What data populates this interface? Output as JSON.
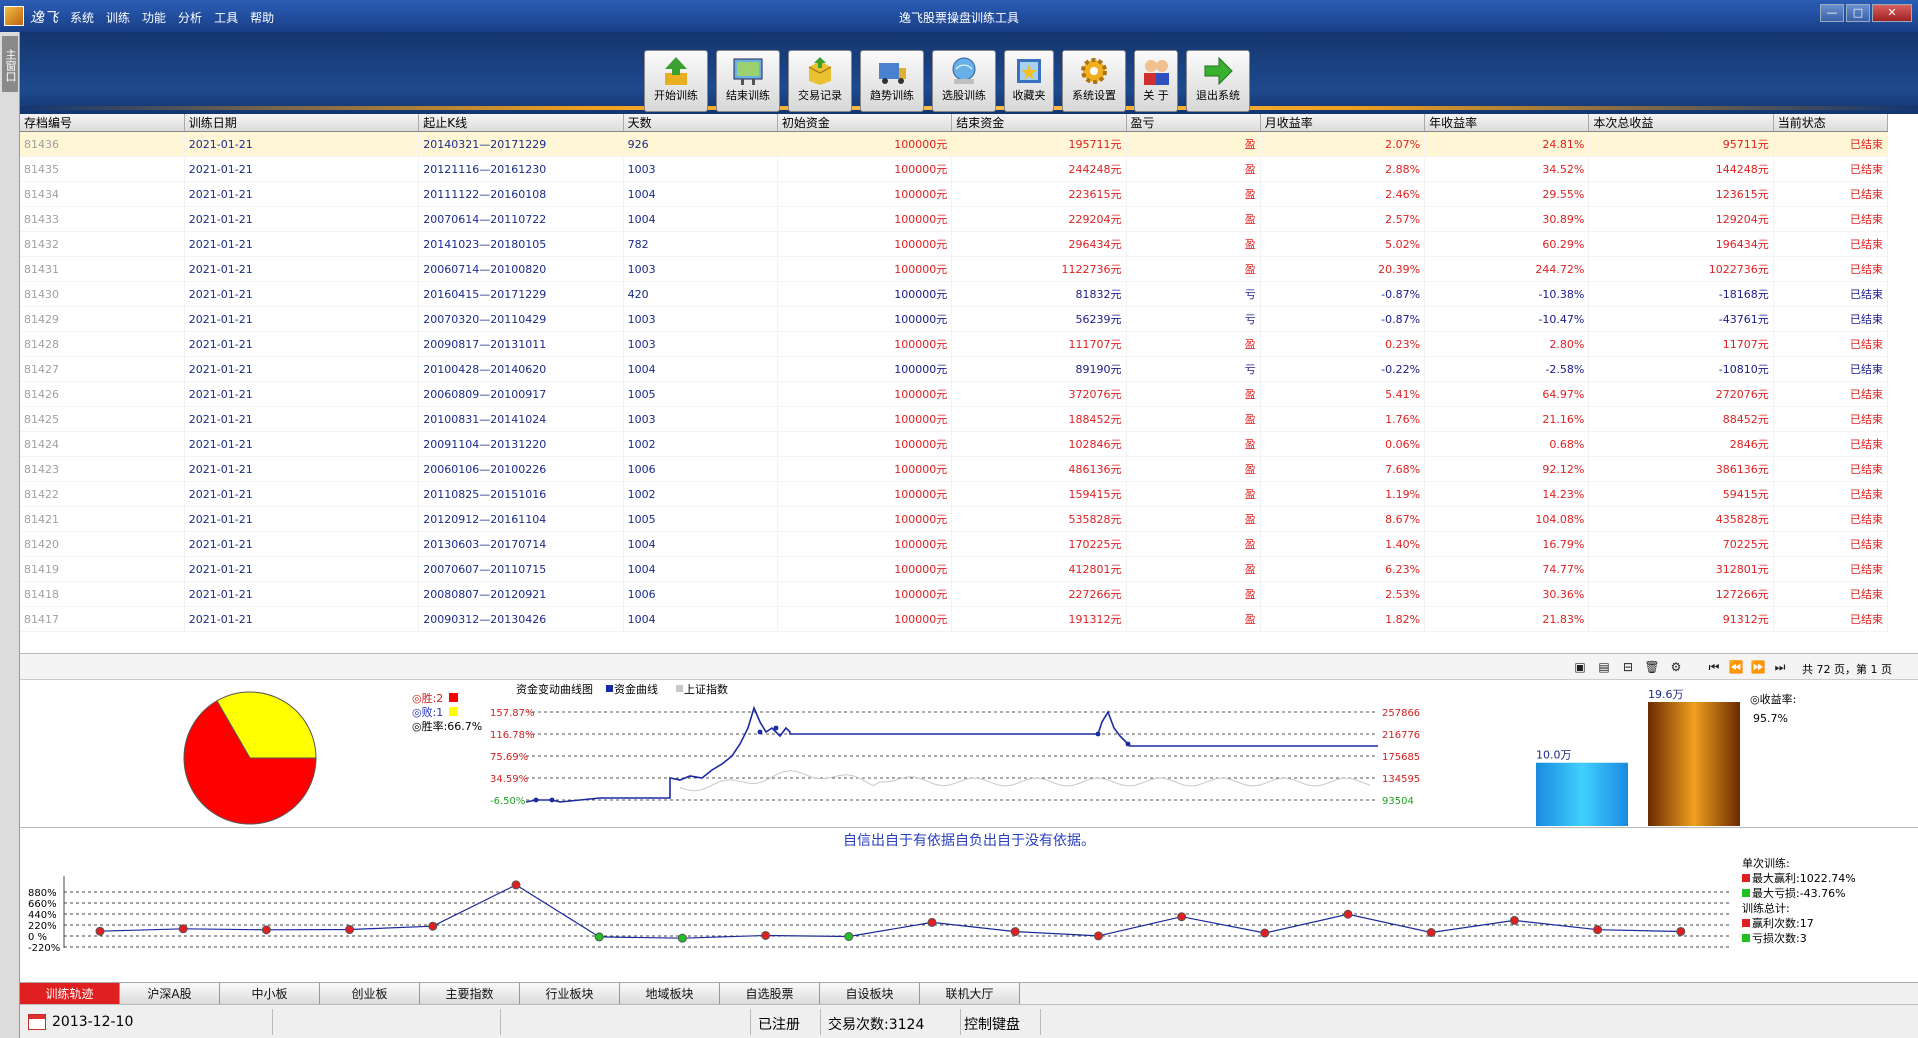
{
  "app": {
    "brand": "逸飞",
    "title": "逸飞股票操盘训练工具",
    "menu": [
      "系统",
      "训练",
      "功能",
      "分析",
      "工具",
      "帮助"
    ],
    "window_buttons": [
      "—",
      "□",
      "✕"
    ]
  },
  "sidetab": {
    "label": "主窗口"
  },
  "toolbar": {
    "buttons": [
      {
        "label": "开始训练",
        "icon": "start-training-icon"
      },
      {
        "label": "结束训练",
        "icon": "end-training-icon"
      },
      {
        "label": "交易记录",
        "icon": "trade-record-icon"
      },
      {
        "label": "趋势训练",
        "icon": "trend-training-icon"
      },
      {
        "label": "选股训练",
        "icon": "stock-pick-icon"
      },
      {
        "label": "收藏夹",
        "icon": "favorites-icon"
      },
      {
        "label": "系统设置",
        "icon": "settings-icon"
      },
      {
        "label": "关 于",
        "icon": "about-icon"
      },
      {
        "label": "退出系统",
        "icon": "exit-icon"
      }
    ]
  },
  "table": {
    "headers": [
      "存档编号",
      "训练日期",
      "起止K线",
      "天数",
      "初始资金",
      "结束资金",
      "盈亏",
      "月收益率",
      "年收益率",
      "本次总收益",
      "当前状态"
    ],
    "rows": [
      {
        "id": "81436",
        "date": "2021-01-21",
        "range": "20140321—20171229",
        "days": "926",
        "init": "100000元",
        "end": "195711元",
        "pl": "盈",
        "monthly": "2.07%",
        "yearly": "24.81%",
        "total": "95711元",
        "status": "已结束",
        "win": true
      },
      {
        "id": "81435",
        "date": "2021-01-21",
        "range": "20121116—20161230",
        "days": "1003",
        "init": "100000元",
        "end": "244248元",
        "pl": "盈",
        "monthly": "2.88%",
        "yearly": "34.52%",
        "total": "144248元",
        "status": "已结束",
        "win": true
      },
      {
        "id": "81434",
        "date": "2021-01-21",
        "range": "20111122—20160108",
        "days": "1004",
        "init": "100000元",
        "end": "223615元",
        "pl": "盈",
        "monthly": "2.46%",
        "yearly": "29.55%",
        "total": "123615元",
        "status": "已结束",
        "win": true
      },
      {
        "id": "81433",
        "date": "2021-01-21",
        "range": "20070614—20110722",
        "days": "1004",
        "init": "100000元",
        "end": "229204元",
        "pl": "盈",
        "monthly": "2.57%",
        "yearly": "30.89%",
        "total": "129204元",
        "status": "已结束",
        "win": true
      },
      {
        "id": "81432",
        "date": "2021-01-21",
        "range": "20141023—20180105",
        "days": "782",
        "init": "100000元",
        "end": "296434元",
        "pl": "盈",
        "monthly": "5.02%",
        "yearly": "60.29%",
        "total": "196434元",
        "status": "已结束",
        "win": true
      },
      {
        "id": "81431",
        "date": "2021-01-21",
        "range": "20060714—20100820",
        "days": "1003",
        "init": "100000元",
        "end": "1122736元",
        "pl": "盈",
        "monthly": "20.39%",
        "yearly": "244.72%",
        "total": "1022736元",
        "status": "已结束",
        "win": true
      },
      {
        "id": "81430",
        "date": "2021-01-21",
        "range": "20160415—20171229",
        "days": "420",
        "init": "100000元",
        "end": "81832元",
        "pl": "亏",
        "monthly": "-0.87%",
        "yearly": "-10.38%",
        "total": "-18168元",
        "status": "已结束",
        "win": false
      },
      {
        "id": "81429",
        "date": "2021-01-21",
        "range": "20070320—20110429",
        "days": "1003",
        "init": "100000元",
        "end": "56239元",
        "pl": "亏",
        "monthly": "-0.87%",
        "yearly": "-10.47%",
        "total": "-43761元",
        "status": "已结束",
        "win": false
      },
      {
        "id": "81428",
        "date": "2021-01-21",
        "range": "20090817—20131011",
        "days": "1003",
        "init": "100000元",
        "end": "111707元",
        "pl": "盈",
        "monthly": "0.23%",
        "yearly": "2.80%",
        "total": "11707元",
        "status": "已结束",
        "win": true
      },
      {
        "id": "81427",
        "date": "2021-01-21",
        "range": "20100428—20140620",
        "days": "1004",
        "init": "100000元",
        "end": "89190元",
        "pl": "亏",
        "monthly": "-0.22%",
        "yearly": "-2.58%",
        "total": "-10810元",
        "status": "已结束",
        "win": false
      },
      {
        "id": "81426",
        "date": "2021-01-21",
        "range": "20060809—20100917",
        "days": "1005",
        "init": "100000元",
        "end": "372076元",
        "pl": "盈",
        "monthly": "5.41%",
        "yearly": "64.97%",
        "total": "272076元",
        "status": "已结束",
        "win": true
      },
      {
        "id": "81425",
        "date": "2021-01-21",
        "range": "20100831—20141024",
        "days": "1003",
        "init": "100000元",
        "end": "188452元",
        "pl": "盈",
        "monthly": "1.76%",
        "yearly": "21.16%",
        "total": "88452元",
        "status": "已结束",
        "win": true
      },
      {
        "id": "81424",
        "date": "2021-01-21",
        "range": "20091104—20131220",
        "days": "1002",
        "init": "100000元",
        "end": "102846元",
        "pl": "盈",
        "monthly": "0.06%",
        "yearly": "0.68%",
        "total": "2846元",
        "status": "已结束",
        "win": true
      },
      {
        "id": "81423",
        "date": "2021-01-21",
        "range": "20060106—20100226",
        "days": "1006",
        "init": "100000元",
        "end": "486136元",
        "pl": "盈",
        "monthly": "7.68%",
        "yearly": "92.12%",
        "total": "386136元",
        "status": "已结束",
        "win": true
      },
      {
        "id": "81422",
        "date": "2021-01-21",
        "range": "20110825—20151016",
        "days": "1002",
        "init": "100000元",
        "end": "159415元",
        "pl": "盈",
        "monthly": "1.19%",
        "yearly": "14.23%",
        "total": "59415元",
        "status": "已结束",
        "win": true
      },
      {
        "id": "81421",
        "date": "2021-01-21",
        "range": "20120912—20161104",
        "days": "1005",
        "init": "100000元",
        "end": "535828元",
        "pl": "盈",
        "monthly": "8.67%",
        "yearly": "104.08%",
        "total": "435828元",
        "status": "已结束",
        "win": true
      },
      {
        "id": "81420",
        "date": "2021-01-21",
        "range": "20130603—20170714",
        "days": "1004",
        "init": "100000元",
        "end": "170225元",
        "pl": "盈",
        "monthly": "1.40%",
        "yearly": "16.79%",
        "total": "70225元",
        "status": "已结束",
        "win": true
      },
      {
        "id": "81419",
        "date": "2021-01-21",
        "range": "20070607—20110715",
        "days": "1004",
        "init": "100000元",
        "end": "412801元",
        "pl": "盈",
        "monthly": "6.23%",
        "yearly": "74.77%",
        "total": "312801元",
        "status": "已结束",
        "win": true
      },
      {
        "id": "81418",
        "date": "2021-01-21",
        "range": "20080807—20120921",
        "days": "1006",
        "init": "100000元",
        "end": "227266元",
        "pl": "盈",
        "monthly": "2.53%",
        "yearly": "30.36%",
        "total": "127266元",
        "status": "已结束",
        "win": true
      },
      {
        "id": "81417",
        "date": "2021-01-21",
        "range": "20090312—20130426",
        "days": "1004",
        "init": "100000元",
        "end": "191312元",
        "pl": "盈",
        "monthly": "1.82%",
        "yearly": "21.83%",
        "total": "91312元",
        "status": "已结束",
        "win": true
      }
    ]
  },
  "pager": {
    "tool_icons": [
      "preview-icon",
      "export-icon",
      "minus-icon",
      "delete-icon",
      "settings-icon"
    ],
    "nav": [
      "⏮",
      "⏪",
      "⏩",
      "⏭"
    ],
    "info": "共 72 页，第 1 页"
  },
  "winrate": {
    "win_label": "◎胜:2",
    "loss_label": "◎败:1",
    "rate_label": "◎胜率:66.7%",
    "win_color": "#ff0000",
    "loss_color": "#ffff00",
    "win": 2,
    "loss": 1
  },
  "curve": {
    "title": "资金变动曲线图",
    "legend_fund": "资金曲线",
    "legend_index": "上证指数",
    "left_ticks": [
      "157.87%",
      "116.78%",
      "75.69%",
      "34.59%",
      "-6.50%"
    ],
    "right_ticks": [
      "257866",
      "216776",
      "175685",
      "134595",
      "93504"
    ],
    "fund_color": "#1a2aa0",
    "index_color": "#c8c8c8"
  },
  "bars": {
    "start_label": "10.0万",
    "end_label": "19.6万",
    "start_value": 10.0,
    "end_value": 19.6,
    "rate_title": "◎收益率:",
    "rate_value": "95.7%"
  },
  "motto": "自信出自于有依据自负出自于没有依据。",
  "trajectory": {
    "y_ticks": [
      "880%",
      "660%",
      "440%",
      "220%",
      "0 %",
      "-220%"
    ],
    "values": [
      95.7,
      144,
      123,
      129,
      196,
      1022,
      -18,
      -43,
      11,
      -10,
      272,
      88,
      2,
      386,
      59,
      435,
      70,
      312,
      127,
      91
    ],
    "legend": {
      "single_title": "单次训练:",
      "max_gain": "最大赢利:1022.74%",
      "max_loss": "最大亏损:-43.76%",
      "total_title": "训练总计:",
      "win_count": "赢利次数:17",
      "loss_count": "亏损次数:3"
    }
  },
  "bottom_tabs": [
    "训练轨迹",
    "沪深A股",
    "中小板",
    "创业板",
    "主要指数",
    "行业板块",
    "地域板块",
    "自选股票",
    "自设板块",
    "联机大厅"
  ],
  "status": {
    "date": "2013-12-10",
    "registered": "已注册",
    "trades": "交易次数:3124",
    "keyboard": "控制键盘"
  }
}
